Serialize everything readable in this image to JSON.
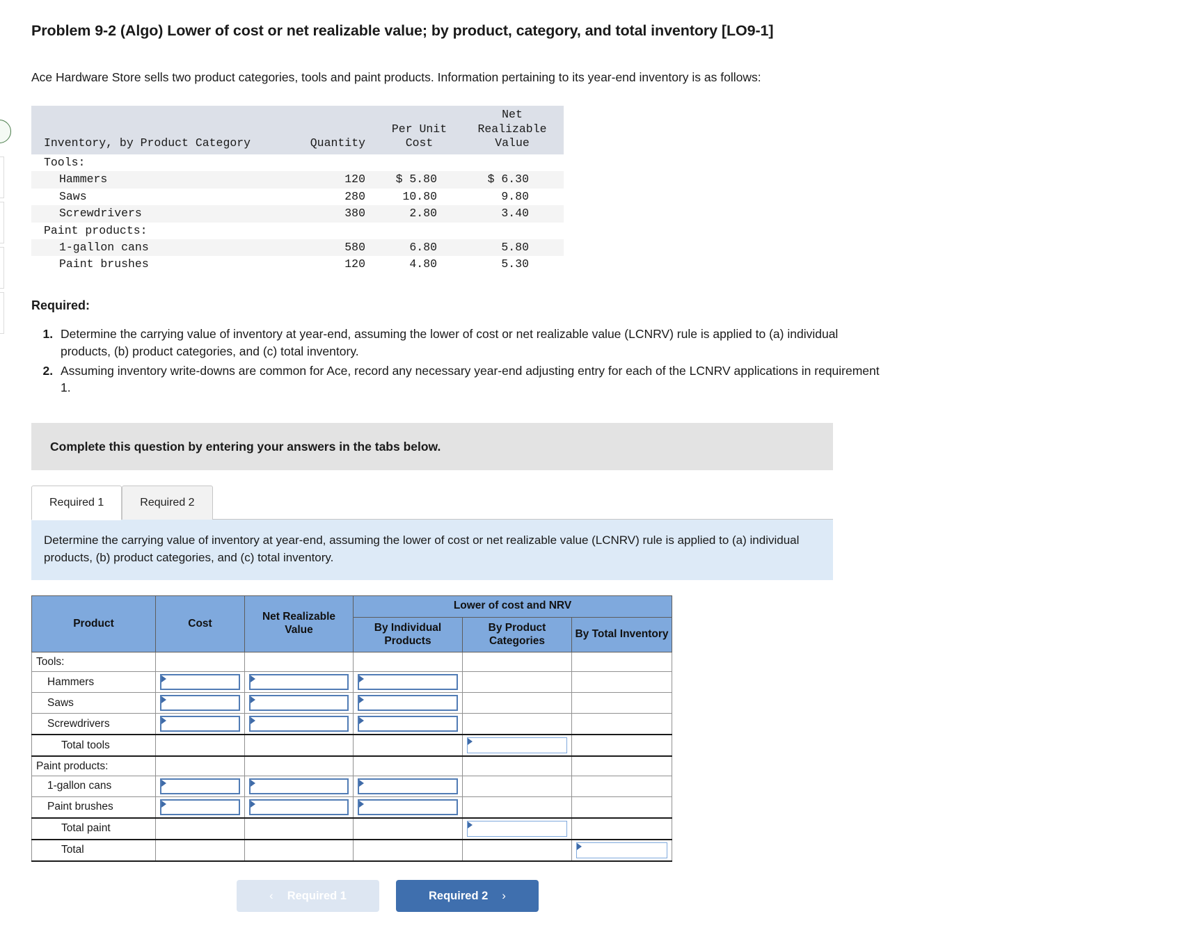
{
  "problem": {
    "title": "Problem 9-2 (Algo) Lower of cost or net realizable value; by product, category, and total inventory [LO9-1]",
    "intro": "Ace Hardware Store sells two product categories, tools and paint products. Information pertaining to its year-end inventory is as follows:"
  },
  "inventory_table": {
    "headers": {
      "label": "Inventory, by Product Category",
      "quantity": "Quantity",
      "per_unit_cost_line1": "Per Unit",
      "per_unit_cost_line2": "Cost",
      "nrv_line1": "Net Realizable",
      "nrv_line2": "Value"
    },
    "rows": [
      {
        "label": "Tools:",
        "indent": 0,
        "quantity": "",
        "cost": "",
        "nrv": "",
        "shaded": false
      },
      {
        "label": "Hammers",
        "indent": 1,
        "quantity": "120",
        "cost": "$ 5.80",
        "nrv": "$ 6.30",
        "shaded": true
      },
      {
        "label": "Saws",
        "indent": 1,
        "quantity": "280",
        "cost": "10.80",
        "nrv": "9.80",
        "shaded": false
      },
      {
        "label": "Screwdrivers",
        "indent": 1,
        "quantity": "380",
        "cost": "2.80",
        "nrv": "3.40",
        "shaded": true
      },
      {
        "label": "Paint products:",
        "indent": 0,
        "quantity": "",
        "cost": "",
        "nrv": "",
        "shaded": false
      },
      {
        "label": "1-gallon cans",
        "indent": 1,
        "quantity": "580",
        "cost": "6.80",
        "nrv": "5.80",
        "shaded": true
      },
      {
        "label": "Paint brushes",
        "indent": 1,
        "quantity": "120",
        "cost": "4.80",
        "nrv": "5.30",
        "shaded": false
      }
    ]
  },
  "required": {
    "heading": "Required:",
    "items": [
      "Determine the carrying value of inventory at year-end, assuming the lower of cost or net realizable value (LCNRV) rule is applied to (a) individual products, (b) product categories, and (c) total inventory.",
      "Assuming inventory write-downs are common for Ace, record any necessary year-end adjusting entry for each of the LCNRV applications in requirement 1."
    ]
  },
  "grey_banner": "Complete this question by entering your answers in the tabs below.",
  "tabs": [
    {
      "label": "Required 1",
      "active": true
    },
    {
      "label": "Required 2",
      "active": false
    }
  ],
  "blue_banner": "Determine the carrying value of inventory at year-end, assuming the lower of cost or net realizable value (LCNRV) rule is applied to (a) individual products, (b) product categories, and (c) total inventory.",
  "answer_table": {
    "headers": {
      "product": "Product",
      "cost": "Cost",
      "nrv": "Net Realizable Value",
      "group": "Lower of cost and NRV",
      "by_individual": "By Individual Products",
      "by_category": "By Product Categories",
      "by_total": "By Total Inventory"
    },
    "rows": [
      {
        "label": "Tools:",
        "indent": 0,
        "cost": "",
        "nrv": "",
        "individual": "",
        "category": "",
        "total": "",
        "inputs": []
      },
      {
        "label": "Hammers",
        "indent": 1,
        "cost": "",
        "nrv": "",
        "individual": "",
        "category": "",
        "total": "",
        "inputs": [
          "cost",
          "nrv",
          "individual"
        ]
      },
      {
        "label": "Saws",
        "indent": 1,
        "cost": "",
        "nrv": "",
        "individual": "",
        "category": "",
        "total": "",
        "inputs": [
          "cost",
          "nrv",
          "individual"
        ]
      },
      {
        "label": "Screwdrivers",
        "indent": 1,
        "cost": "",
        "nrv": "",
        "individual": "",
        "category": "",
        "total": "",
        "inputs": [
          "cost",
          "nrv",
          "individual"
        ],
        "thickbot": true
      },
      {
        "label": "Total tools",
        "indent": 2,
        "cost": "",
        "nrv": "",
        "individual": "",
        "category": "",
        "total": "",
        "inputs": [
          "category"
        ],
        "thickbot": true
      },
      {
        "label": "Paint products:",
        "indent": 0,
        "cost": "",
        "nrv": "",
        "individual": "",
        "category": "",
        "total": "",
        "inputs": []
      },
      {
        "label": "1-gallon cans",
        "indent": 1,
        "cost": "",
        "nrv": "",
        "individual": "",
        "category": "",
        "total": "",
        "inputs": [
          "cost",
          "nrv",
          "individual"
        ]
      },
      {
        "label": "Paint brushes",
        "indent": 1,
        "cost": "",
        "nrv": "",
        "individual": "",
        "category": "",
        "total": "",
        "inputs": [
          "cost",
          "nrv",
          "individual"
        ],
        "thickbot": true
      },
      {
        "label": "Total paint",
        "indent": 2,
        "cost": "",
        "nrv": "",
        "individual": "",
        "category": "",
        "total": "",
        "inputs": [
          "category"
        ],
        "thickbot": true
      },
      {
        "label": "Total",
        "indent": 2,
        "cost": "",
        "nrv": "",
        "individual": "",
        "category": "",
        "total": "",
        "inputs": [
          "total"
        ],
        "lastrow": true
      }
    ]
  },
  "nav": {
    "prev_label": "Required 1",
    "next_label": "Required 2",
    "prev_chevron": "‹",
    "next_chevron": "›"
  },
  "colors": {
    "header_blue": "#7fa9dd",
    "banner_blue": "#ddeaf7",
    "banner_grey": "#e3e3e3",
    "button_blue": "#3f6fae",
    "button_disabled": "#dde6f2",
    "input_border": "#517cb5"
  }
}
